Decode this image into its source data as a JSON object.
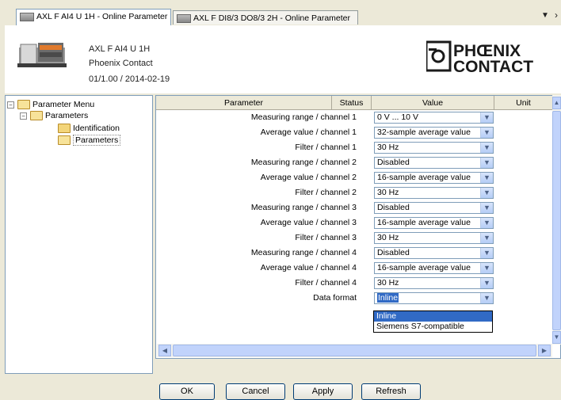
{
  "tabs": [
    {
      "label": "AXL F AI4 U 1H - Online Parameter",
      "active": true
    },
    {
      "label": "AXL F DI8/3 DO8/3 2H - Online Parameter",
      "active": false
    }
  ],
  "tab_controls": {
    "dropdown": "▼",
    "next": "›"
  },
  "device": {
    "name": "AXL F AI4 U 1H",
    "manufacturer": "Phoenix Contact",
    "version": "01/1.00 / 2014-02-19",
    "logo_line1": "PHŒNIX",
    "logo_line2": "CONTACT"
  },
  "tree": {
    "root": "Parameter Menu",
    "child": "Parameters",
    "leaf1": "Identification",
    "leaf2": "Parameters"
  },
  "grid": {
    "headers": {
      "parameter": "Parameter",
      "status": "Status",
      "value": "Value",
      "unit": "Unit"
    },
    "rows": [
      {
        "name": "Measuring range / channel 1",
        "value": "0 V ... 10 V"
      },
      {
        "name": "Average value / channel 1",
        "value": "32-sample average value"
      },
      {
        "name": "Filter / channel 1",
        "value": "30 Hz"
      },
      {
        "name": "Measuring range / channel 2",
        "value": "Disabled"
      },
      {
        "name": "Average value / channel 2",
        "value": "16-sample average value"
      },
      {
        "name": "Filter / channel 2",
        "value": "30 Hz"
      },
      {
        "name": "Measuring range / channel 3",
        "value": "Disabled"
      },
      {
        "name": "Average value / channel 3",
        "value": "16-sample average value"
      },
      {
        "name": "Filter / channel 3",
        "value": "30 Hz"
      },
      {
        "name": "Measuring range / channel 4",
        "value": "Disabled"
      },
      {
        "name": "Average value / channel 4",
        "value": "16-sample average value"
      },
      {
        "name": "Filter / channel 4",
        "value": "30 Hz"
      },
      {
        "name": "Data format",
        "value": "Inline"
      }
    ],
    "dropdown_options": [
      "Inline",
      "Siemens S7-compatible"
    ],
    "dropdown_selected": "Inline"
  },
  "buttons": {
    "ok": "OK",
    "cancel": "Cancel",
    "apply": "Apply",
    "refresh": "Refresh"
  },
  "colors": {
    "selection": "#316ac5",
    "border": "#7f9db9",
    "face": "#ece9d8",
    "logo": "#1a1a1a"
  }
}
